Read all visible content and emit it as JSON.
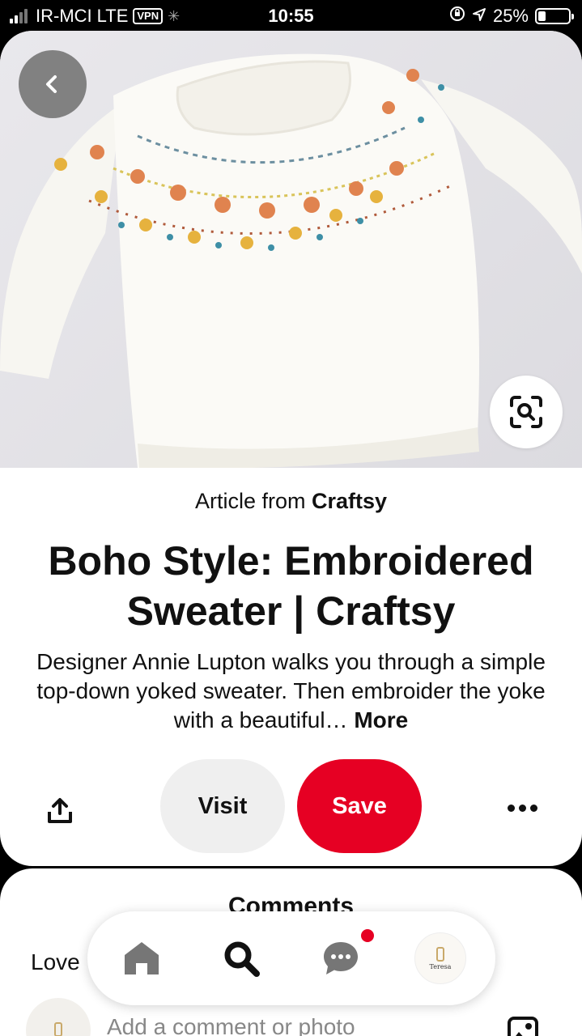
{
  "status_bar": {
    "carrier": "IR-MCI",
    "network": "LTE",
    "vpn": "VPN",
    "time": "10:55",
    "battery": "25%",
    "battery_level": 0.25
  },
  "pin": {
    "source_prefix": "Article from",
    "source_name": "Craftsy",
    "title": "Boho Style: Embroidered Sweater | Craftsy",
    "description": "Designer Annie Lupton walks you through a simple top-down yoked sweater. Then embroider the yoke with a beautiful…",
    "more_label": "More"
  },
  "actions": {
    "visit_label": "Visit",
    "save_label": "Save"
  },
  "comments": {
    "title": "Comments",
    "first_comment": "Love",
    "input_placeholder": "Add a comment or photo"
  },
  "colors": {
    "brand_red": "#e60023",
    "visit_bg": "#efefef"
  },
  "icons": {
    "back": "back-icon",
    "lens": "visual-search-icon",
    "share": "share-icon",
    "more": "more-icon",
    "home": "home-icon",
    "search": "search-icon",
    "messages": "messages-icon",
    "photo": "photo-icon"
  },
  "nav": {
    "profile_text": "Teresa"
  }
}
